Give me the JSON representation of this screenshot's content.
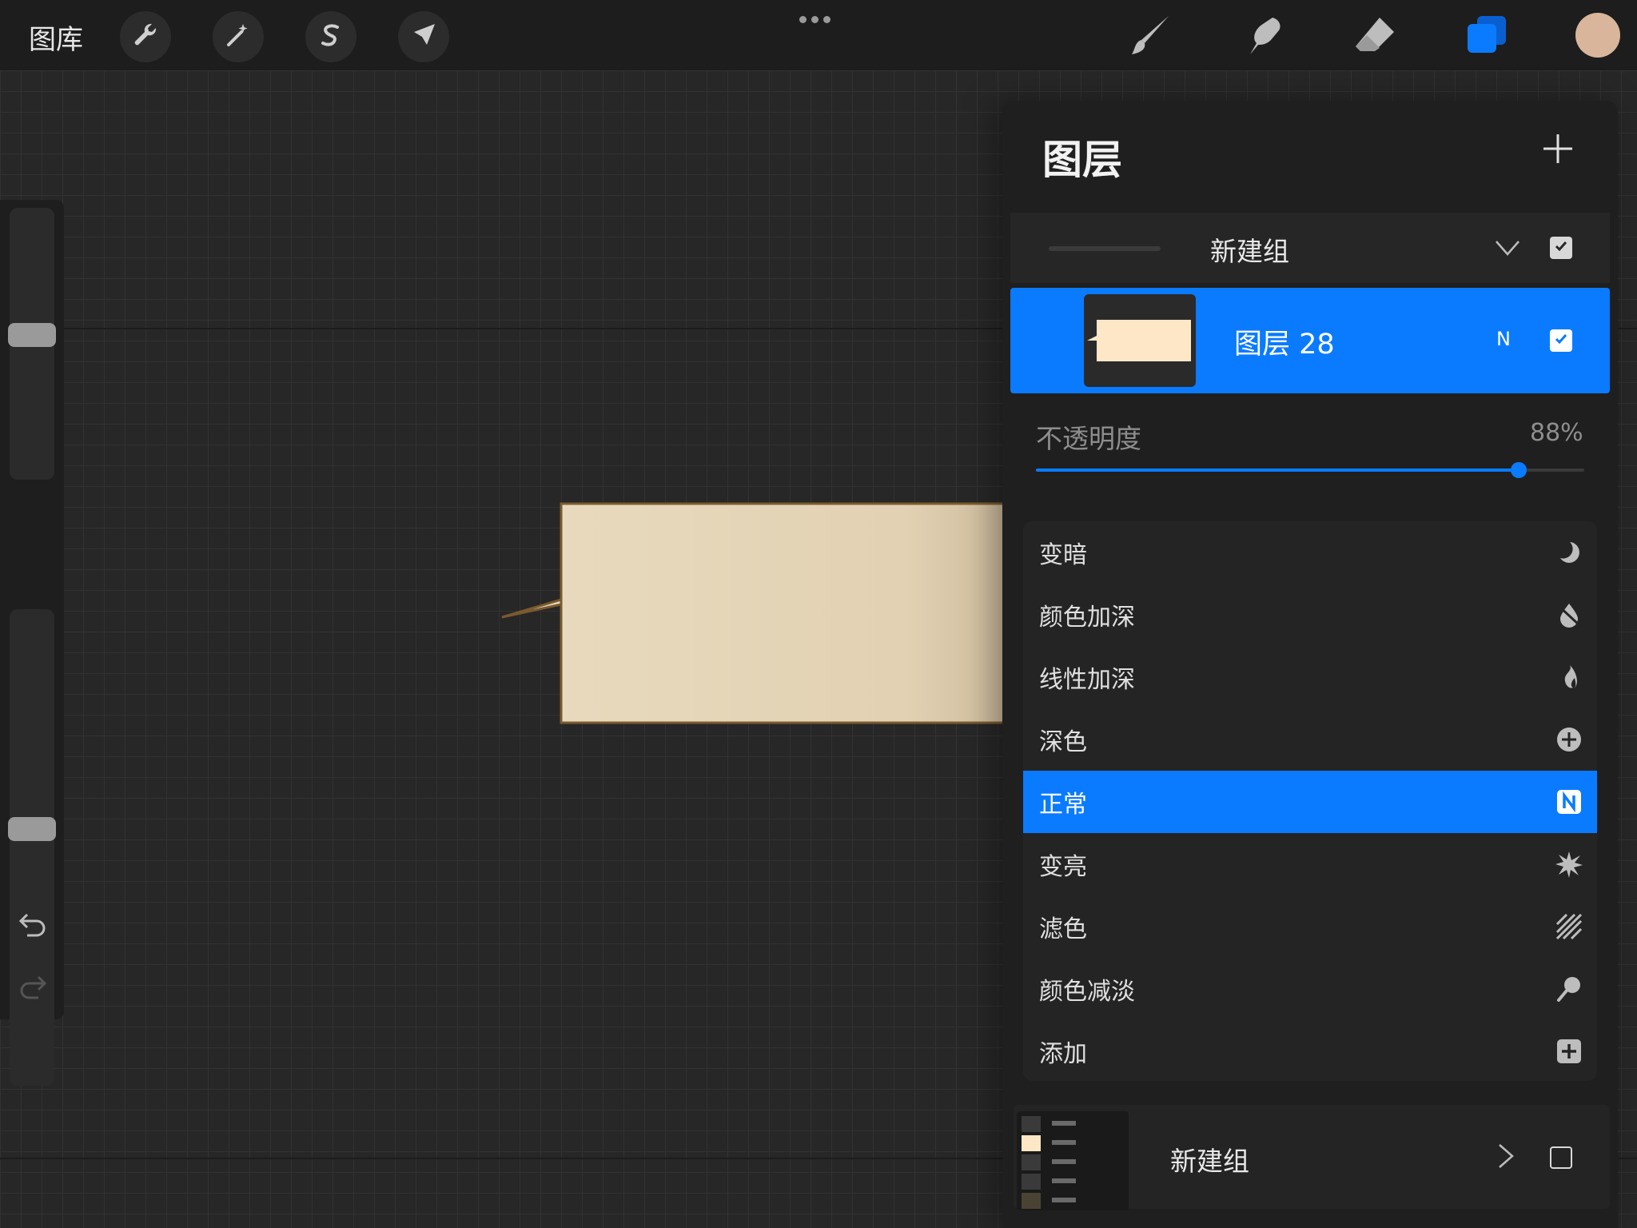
{
  "topbar": {
    "gallery_label": "图库",
    "left_tools": [
      "wrench-icon",
      "magic-wand-icon",
      "selection-icon",
      "transform-arrow-icon"
    ],
    "right_tools": [
      "brush-icon",
      "smudge-icon",
      "eraser-icon",
      "layers-icon"
    ],
    "active_tool": "layers-icon",
    "current_color": "#d9b59b"
  },
  "layers_panel": {
    "title": "图层",
    "group_top": {
      "name": "新建组",
      "expanded": true,
      "visible": true
    },
    "selected_layer": {
      "name": "图层 28",
      "blend_mode_short": "N",
      "visible": true
    },
    "opacity": {
      "label": "不透明度",
      "value_text": "88%",
      "value": 0.88
    },
    "blend_modes": [
      {
        "label": "变暗",
        "icon": "moon-icon"
      },
      {
        "label": "颜色加深",
        "icon": "burn-drop-icon"
      },
      {
        "label": "线性加深",
        "icon": "flame-icon"
      },
      {
        "label": "深色",
        "icon": "darker-plus-icon"
      },
      {
        "label": "正常",
        "icon": "normal-n-icon",
        "selected": true
      },
      {
        "label": "变亮",
        "icon": "starburst-icon"
      },
      {
        "label": "滤色",
        "icon": "hatch-icon"
      },
      {
        "label": "颜色减淡",
        "icon": "dodge-icon"
      },
      {
        "label": "添加",
        "icon": "add-square-icon"
      }
    ],
    "group_bottom": {
      "name": "新建组",
      "expanded": false,
      "visible": false
    }
  },
  "colors": {
    "accent": "#0a7bff",
    "bubble_fill": "#e8d8bc",
    "bubble_stroke": "#7a5a2e"
  }
}
